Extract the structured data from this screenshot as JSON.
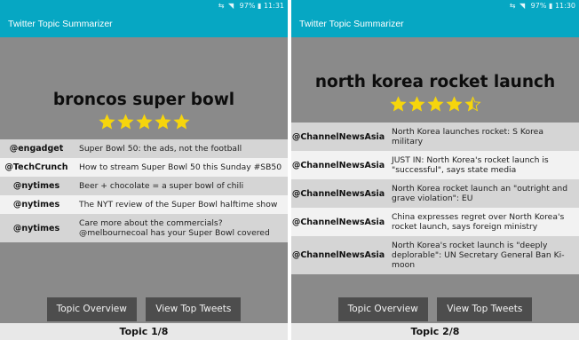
{
  "status_bar": {
    "icons": "⇆ ◥",
    "battery": "97%",
    "time": "11:31"
  },
  "status_bar_2": {
    "icons": "⇆ ◥",
    "battery": "97%",
    "time": "11:30"
  },
  "app_title": "Twitter Topic Summarizer",
  "colors": {
    "accent": "#06a7c3",
    "star": "#f6d50c",
    "button": "#4d4d4d",
    "background": "#8a8a8a"
  },
  "screens": [
    {
      "topic": "broncos super bowl",
      "rating": 5,
      "tweets": [
        {
          "handle": "@engadget",
          "text": "Super Bowl 50: the ads, not the football"
        },
        {
          "handle": "@TechCrunch",
          "text": "How to stream Super Bowl 50 this Sunday #SB50"
        },
        {
          "handle": "@nytimes",
          "text": "Beer + chocolate = a super bowl of chili"
        },
        {
          "handle": "@nytimes",
          "text": "The NYT review of the Super Bowl halftime show"
        },
        {
          "handle": "@nytimes",
          "text": "Care more about the commercials? @melbournecoal has your Super Bowl covered"
        }
      ],
      "overview_button": "Topic Overview",
      "tweets_button": "View Top Tweets",
      "pager": "Topic 1/8"
    },
    {
      "topic": "north korea rocket launch",
      "rating": 4.5,
      "tweets": [
        {
          "handle": "@ChannelNewsAsia",
          "text": "North Korea launches rocket: S Korea military"
        },
        {
          "handle": "@ChannelNewsAsia",
          "text": "JUST IN: North Korea's rocket launch is \"successful\", says state media"
        },
        {
          "handle": "@ChannelNewsAsia",
          "text": "North Korea rocket launch an \"outright and grave violation\": EU"
        },
        {
          "handle": "@ChannelNewsAsia",
          "text": "China expresses regret over North Korea's rocket launch, says foreign ministry"
        },
        {
          "handle": "@ChannelNewsAsia",
          "text": "North Korea's rocket launch is \"deeply deplorable\": UN Secretary General Ban Ki-moon"
        }
      ],
      "overview_button": "Topic Overview",
      "tweets_button": "View Top Tweets",
      "pager": "Topic 2/8"
    }
  ]
}
